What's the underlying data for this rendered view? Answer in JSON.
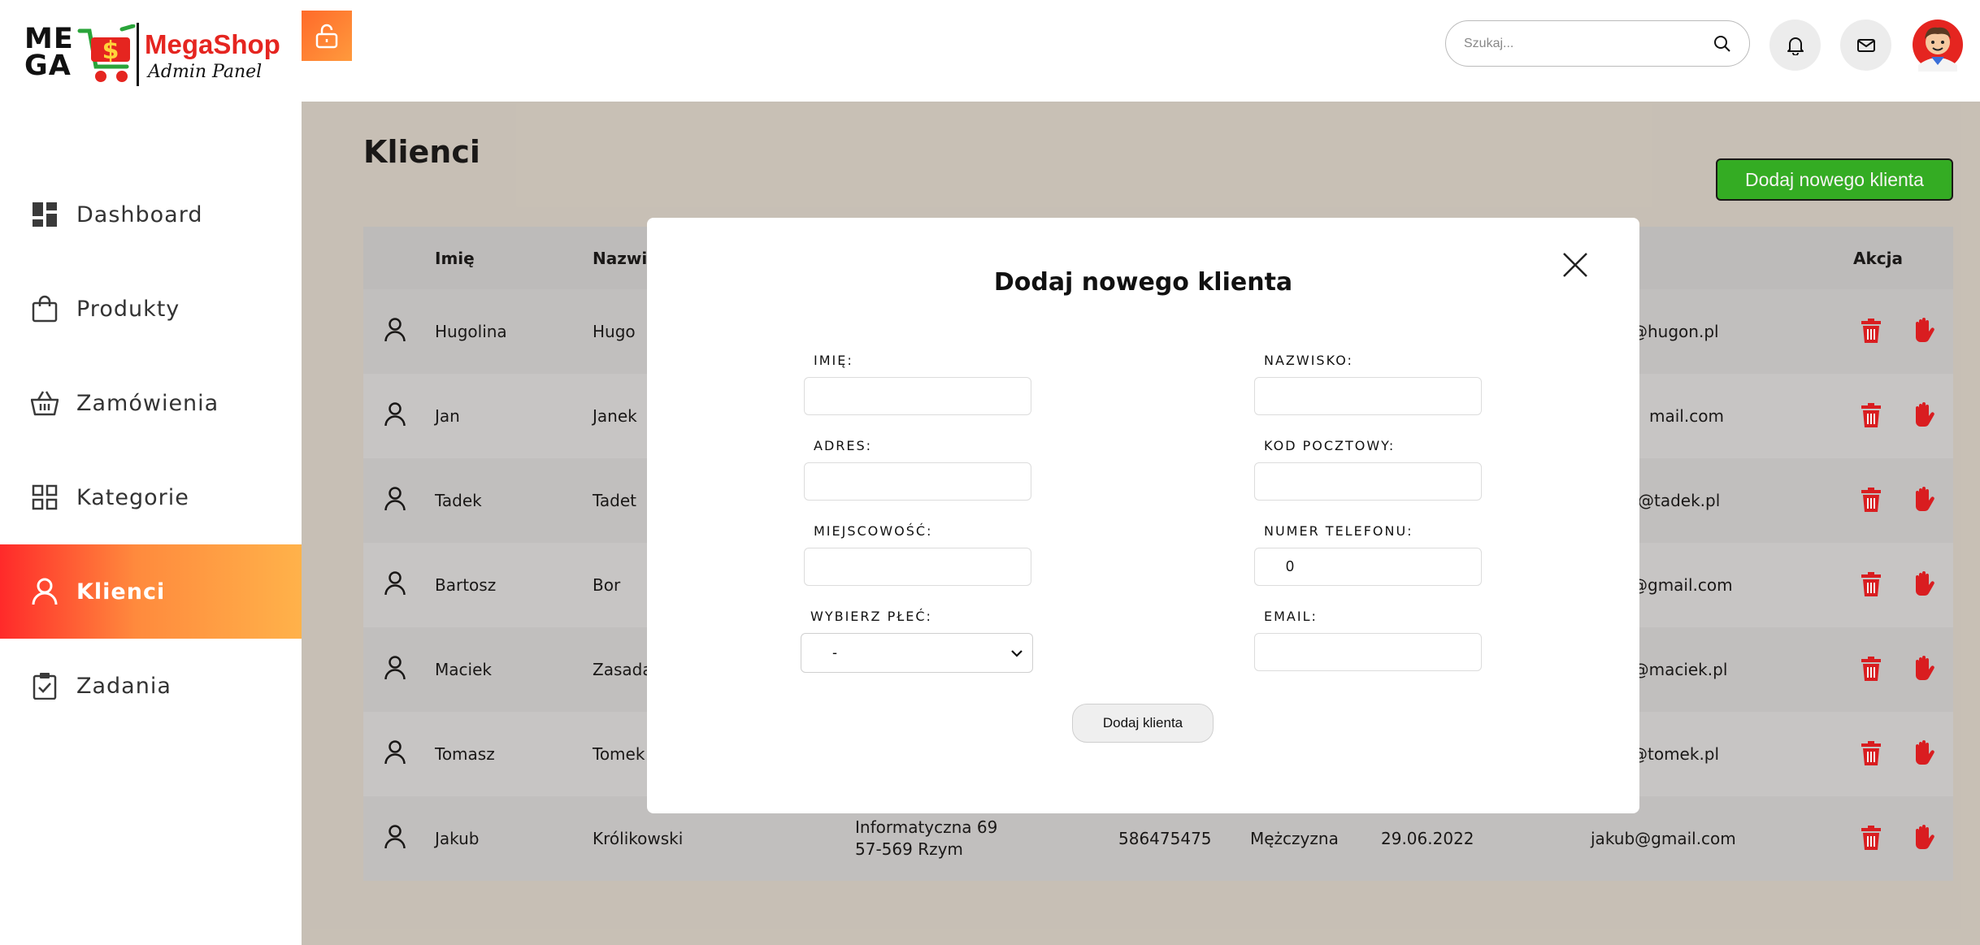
{
  "brand": {
    "logo_text_line1": "ME",
    "logo_text_line2": "GA",
    "name": "MegaShop",
    "subtitle": "Admin Panel"
  },
  "sidebar": {
    "items": [
      {
        "label": "Dashboard",
        "icon": "dashboard-icon",
        "active": false
      },
      {
        "label": "Produkty",
        "icon": "shopping-bag-icon",
        "active": false
      },
      {
        "label": "Zamówienia",
        "icon": "basket-icon",
        "active": false
      },
      {
        "label": "Kategorie",
        "icon": "grid-icon",
        "active": false
      },
      {
        "label": "Klienci",
        "icon": "user-icon",
        "active": true
      },
      {
        "label": "Zadania",
        "icon": "clipboard-check-icon",
        "active": false
      }
    ]
  },
  "topbar": {
    "search_placeholder": "Szukaj...",
    "icons": [
      "lock-open-icon",
      "search-icon",
      "bell-icon",
      "mail-icon",
      "avatar"
    ]
  },
  "page": {
    "title": "Klienci",
    "add_button": "Dodaj nowego klienta"
  },
  "table": {
    "headers": {
      "first_name": "Imię",
      "last_name": "Nazwis",
      "action": "Akcja"
    },
    "rows": [
      {
        "first_name": "Hugolina",
        "last_name": "Hugo",
        "email": "@hugon.pl"
      },
      {
        "first_name": "Jan",
        "last_name": "Janek",
        "email": "mail.com"
      },
      {
        "first_name": "Tadek",
        "last_name": "Tadet",
        "email": "@tadek.pl"
      },
      {
        "first_name": "Bartosz",
        "last_name": "Bor",
        "email": "@gmail.com"
      },
      {
        "first_name": "Maciek",
        "last_name": "Zasada",
        "email": "k@maciek.pl"
      },
      {
        "first_name": "Tomasz",
        "last_name": "Tomek",
        "email": "@tomek.pl"
      },
      {
        "first_name": "Jakub",
        "last_name": "Królikowski",
        "address_line1": "Informatyczna 69",
        "address_line2": "57-569 Rzym",
        "phone": "586475475",
        "gender": "Mężczyzna",
        "date": "29.06.2022",
        "email": "jakub@gmail.com"
      }
    ]
  },
  "modal": {
    "title": "Dodaj nowego klienta",
    "fields": {
      "first_name_label": "IMIĘ:",
      "last_name_label": "NAZWISKO:",
      "address_label": "ADRES:",
      "postal_code_label": "KOD POCZTOWY:",
      "city_label": "MIEJSCOWOŚĆ:",
      "phone_label": "NUMER TELEFONU:",
      "phone_value": "0",
      "gender_label": "WYBIERZ PŁEĆ:",
      "gender_value": "-",
      "email_label": "EMAIL:"
    },
    "submit_label": "Dodaj klienta"
  },
  "colors": {
    "accent_gradient_start": "#ff2a2a",
    "accent_gradient_end": "#ffb24a",
    "add_button": "#2db11e",
    "danger_icon": "#e0161b",
    "main_background": "#cdc6bc"
  }
}
